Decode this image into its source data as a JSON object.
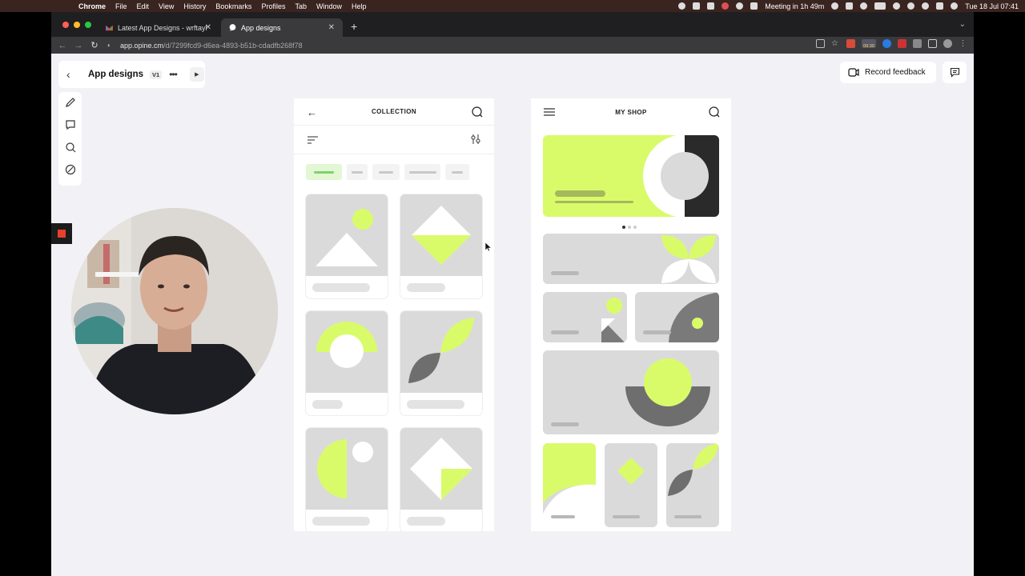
{
  "menubar": {
    "app": "Chrome",
    "items": [
      "File",
      "Edit",
      "View",
      "History",
      "Bookmarks",
      "Profiles",
      "Tab",
      "Window",
      "Help"
    ],
    "meeting": "Meeting in 1h 49m",
    "datetime": "Tue 18 Jul  07:41"
  },
  "browser": {
    "tabs": [
      {
        "label": "Latest App Designs - wrftaylor",
        "icon": "gmail-icon"
      },
      {
        "label": "App designs",
        "icon": "opine-icon"
      }
    ],
    "url_host": "app.opine.cm",
    "url_path": "/d/7299fcd9-d6ea-4893-b51b-cdadfb268f78",
    "ext_badge": "09:30"
  },
  "doc": {
    "title": "App designs",
    "version": "V1",
    "record_label": "Record feedback"
  },
  "phone1": {
    "title": "COLLECTION"
  },
  "phone2": {
    "title": "MY SHOP"
  },
  "colors": {
    "accent": "#d9fb6a",
    "placeholder": "#dadada",
    "dark": "#2a2a2a",
    "mid": "#7a7a7a",
    "chip_active": "#7ed36a",
    "record_red": "#e8412a"
  }
}
